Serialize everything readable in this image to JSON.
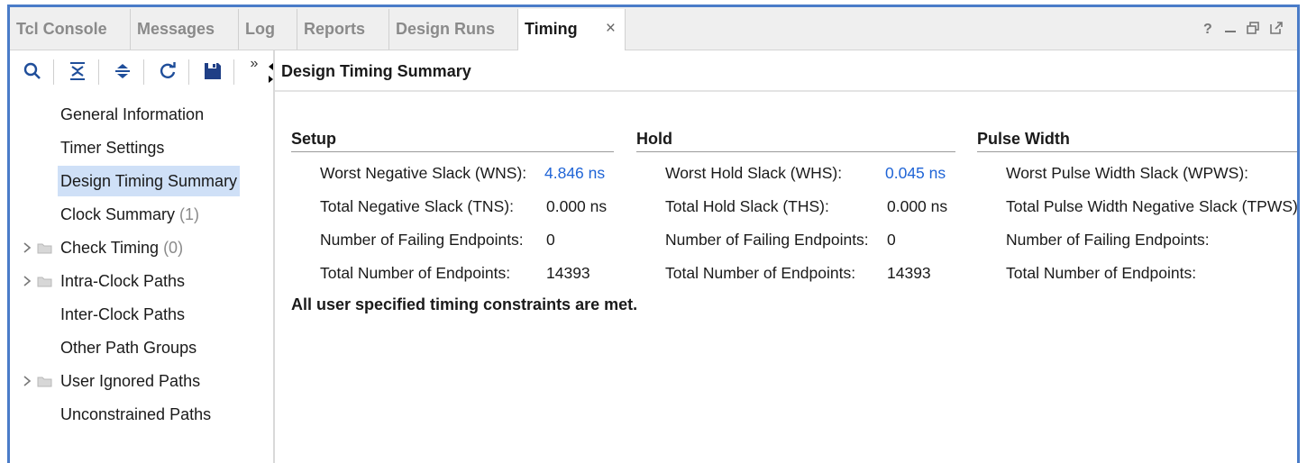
{
  "tabs": [
    {
      "label": "Tcl Console"
    },
    {
      "label": "Messages"
    },
    {
      "label": "Log"
    },
    {
      "label": "Reports"
    },
    {
      "label": "Design Runs"
    },
    {
      "label": "Timing",
      "active": true
    }
  ],
  "tab_close_glyph": "×",
  "window_controls": {
    "help": "?"
  },
  "toolbar": {
    "icons": [
      "search-icon",
      "collapse-all-icon",
      "expand-all-icon",
      "refresh-icon",
      "save-icon"
    ],
    "overflow": "»"
  },
  "nav": {
    "items": [
      {
        "label": "General Information"
      },
      {
        "label": "Timer Settings"
      },
      {
        "label": "Design Timing Summary",
        "selected": true
      },
      {
        "label": "Clock Summary",
        "count": "(1)"
      },
      {
        "label": "Check Timing",
        "count": "(0)",
        "expandable": true
      },
      {
        "label": "Intra-Clock Paths",
        "expandable": true
      },
      {
        "label": "Inter-Clock Paths"
      },
      {
        "label": "Other Path Groups"
      },
      {
        "label": "User Ignored Paths",
        "expandable": true
      },
      {
        "label": "Unconstrained Paths"
      }
    ]
  },
  "main": {
    "title": "Design Timing Summary",
    "setup": {
      "title": "Setup",
      "rows": [
        {
          "label": "Worst Negative Slack (WNS):",
          "value": "4.846 ns",
          "link": true
        },
        {
          "label": "Total Negative Slack (TNS):",
          "value": "0.000 ns"
        },
        {
          "label": "Number of Failing Endpoints:",
          "value": "0"
        },
        {
          "label": "Total Number of Endpoints:",
          "value": "14393"
        }
      ]
    },
    "hold": {
      "title": "Hold",
      "rows": [
        {
          "label": "Worst Hold Slack (WHS):",
          "value": "0.045 ns",
          "link": true
        },
        {
          "label": "Total Hold Slack (THS):",
          "value": "0.000 ns"
        },
        {
          "label": "Number of Failing Endpoints:",
          "value": "0"
        },
        {
          "label": "Total Number of Endpoints:",
          "value": "14393"
        }
      ]
    },
    "pulse_width": {
      "title": "Pulse Width",
      "rows": [
        {
          "label": "Worst Pulse Width Slack (WPWS):"
        },
        {
          "label": "Total Pulse Width Negative Slack (TPWS):"
        },
        {
          "label": "Number of Failing Endpoints:"
        },
        {
          "label": "Total Number of Endpoints:"
        }
      ]
    },
    "status_message": "All user specified timing constraints are met."
  },
  "colors": {
    "accent_border": "#4a7cc8",
    "link": "#1f64d6",
    "selection": "#cfe0f7"
  }
}
